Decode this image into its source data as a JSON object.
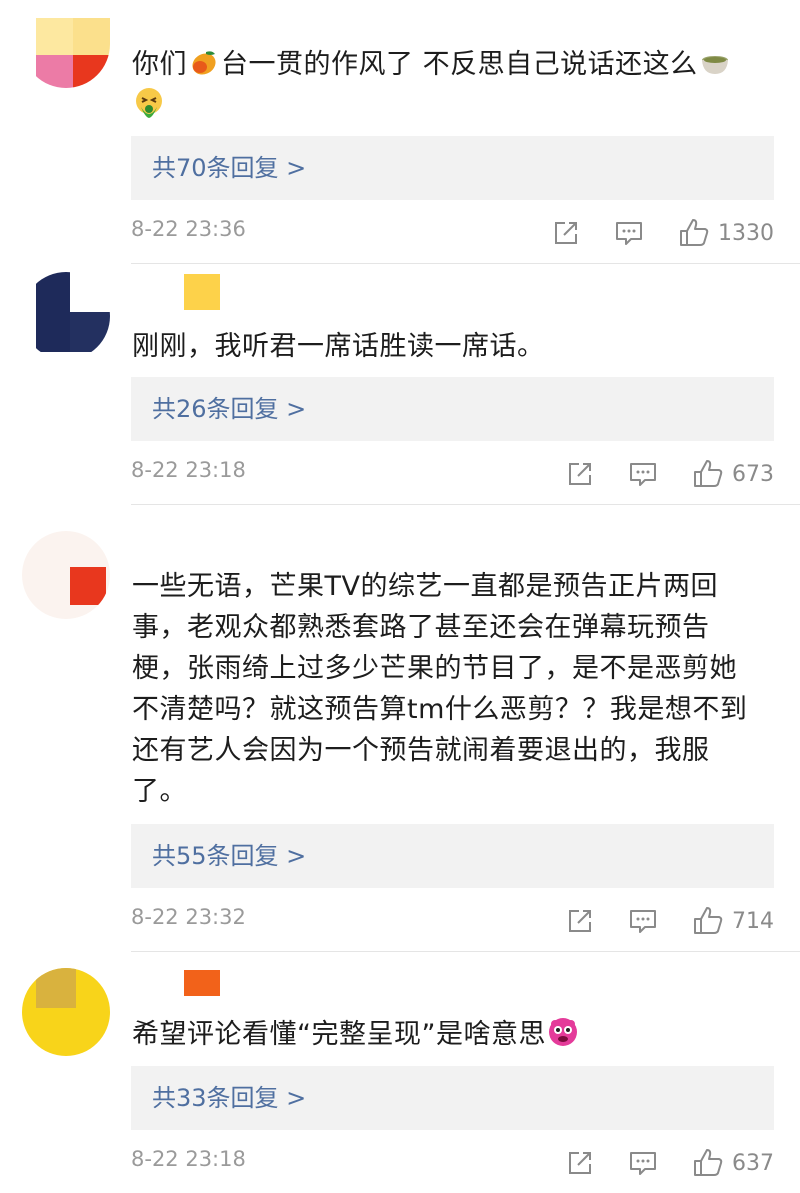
{
  "comments": [
    {
      "text_lines": [
        "你们",
        "台一贯的作风了 不反思自己说话还这么"
      ],
      "emojis": [
        "mango",
        "teacup",
        "vomiting-face"
      ],
      "replies": "共70条回复 >",
      "time": "8-22 23:36",
      "likes": "1330"
    },
    {
      "text_lines": [
        "刚刚，我听君一席话胜读一席话。"
      ],
      "replies": "共26条回复 >",
      "time": "8-22 23:18",
      "likes": "673"
    },
    {
      "text_lines": [
        "一些无语，芒果TV的综艺一直都是预告正片两回",
        "事，老观众都熟悉套路了甚至还会在弹幕玩预告",
        "梗，张雨绮上过多少芒果的节目了，是不是恶剪她",
        "不清楚吗？就这预告算tm什么恶剪？？我是想不到",
        "还有艺人会因为一个预告就闹着要退出的，我服",
        "了。"
      ],
      "replies": "共55条回复 >",
      "time": "8-22 23:32",
      "likes": "714"
    },
    {
      "text_lines": [
        "希望评论看懂“完整呈现”是啥意思"
      ],
      "emojis": [
        "pink-monster"
      ],
      "replies": "共33条回复 >",
      "time": "8-22 23:18",
      "likes": "637"
    }
  ],
  "colors": {
    "reply_link": "#4f6fa0",
    "meta_gray": "#9a9a9a",
    "reply_bg": "#f2f2f2"
  },
  "icons": [
    "share-icon",
    "comment-icon",
    "like-icon"
  ]
}
